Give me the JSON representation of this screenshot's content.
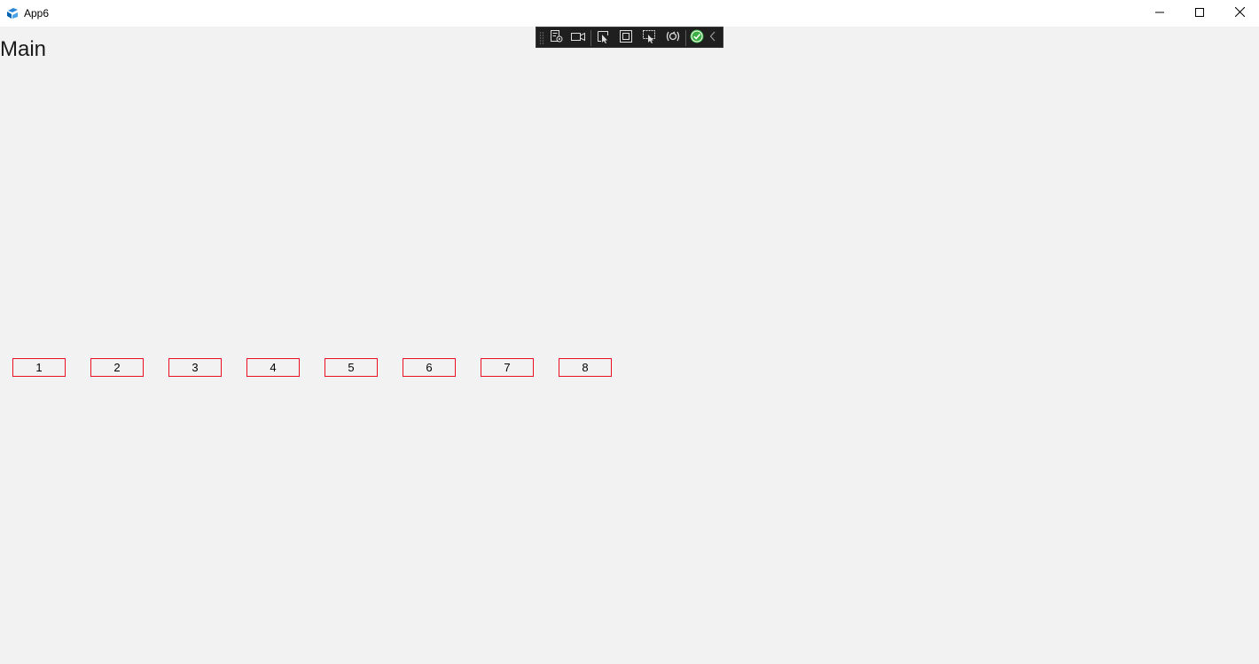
{
  "window": {
    "title": "App6",
    "app_icon": "app-logo-icon",
    "controls": {
      "minimize_icon": "minimize-icon",
      "maximize_icon": "maximize-icon",
      "close_icon": "close-icon"
    }
  },
  "debug_toolbar": {
    "tools": [
      "live-visual-tree-icon",
      "record-icon",
      "select-element-icon",
      "display-layout-adorners-icon",
      "track-focus-icon",
      "hot-reload-icon",
      "binding-status-ok-icon",
      "collapse-chevron-icon"
    ],
    "status_color": "#3cb043"
  },
  "main": {
    "title": "Main",
    "buttons": [
      {
        "label": "1"
      },
      {
        "label": "2"
      },
      {
        "label": "3"
      },
      {
        "label": "4"
      },
      {
        "label": "5"
      },
      {
        "label": "6"
      },
      {
        "label": "7"
      },
      {
        "label": "8"
      }
    ],
    "button_border_color": "#e81123"
  }
}
